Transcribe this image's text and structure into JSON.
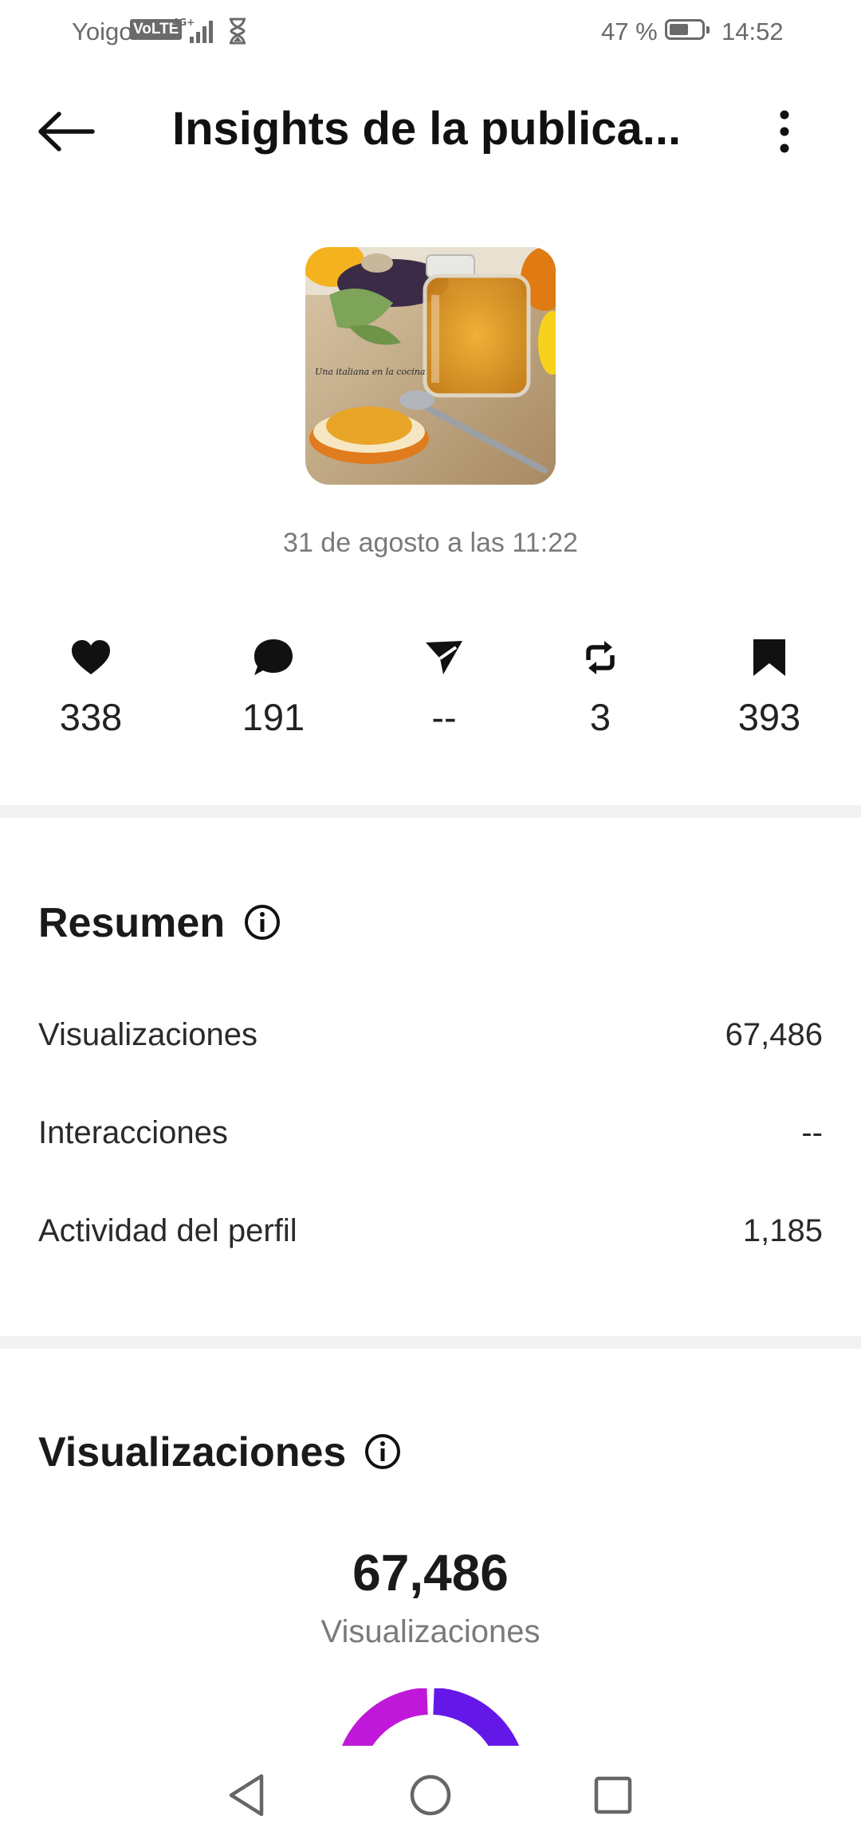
{
  "status_bar": {
    "carrier": "Yoigo",
    "volte": "VoLTE",
    "battery": "47 %",
    "time": "14:52"
  },
  "header": {
    "title": "Insights de la publica...",
    "back_icon": "arrow-left-icon",
    "menu_icon": "more-vertical-icon"
  },
  "post": {
    "thumbnail_icon": "post-thumbnail",
    "date": "31 de agosto a las 11:22"
  },
  "stats": [
    {
      "icon": "heart-icon",
      "value": "338"
    },
    {
      "icon": "comment-icon",
      "value": "191"
    },
    {
      "icon": "share-icon",
      "value": "--"
    },
    {
      "icon": "repost-icon",
      "value": "3"
    },
    {
      "icon": "bookmark-icon",
      "value": "393"
    }
  ],
  "summary": {
    "title": "Resumen",
    "rows": [
      {
        "label": "Visualizaciones",
        "value": "67,486"
      },
      {
        "label": "Interacciones",
        "value": "--"
      },
      {
        "label": "Actividad del perfil",
        "value": "1,185"
      }
    ]
  },
  "views": {
    "title": "Visualizaciones",
    "total": "67,486",
    "label": "Visualizaciones"
  },
  "colors": {
    "donut_magenta": "#c018d8",
    "donut_purple": "#6418e8"
  }
}
